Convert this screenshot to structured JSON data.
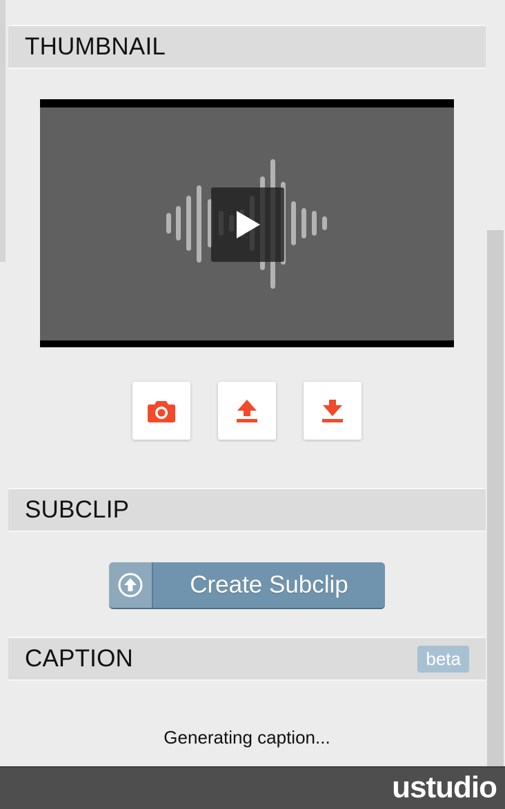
{
  "sections": {
    "thumbnail": {
      "title": "THUMBNAIL"
    },
    "subclip": {
      "title": "SUBCLIP"
    },
    "caption": {
      "title": "CAPTION",
      "badge": "beta"
    }
  },
  "thumbnail_tools": [
    {
      "name": "capture-frame",
      "icon": "camera-icon"
    },
    {
      "name": "upload-thumbnail",
      "icon": "upload-icon"
    },
    {
      "name": "download-thumbnail",
      "icon": "download-icon"
    }
  ],
  "subclip": {
    "button_label": "Create Subclip",
    "icon": "arrow-up-circle-icon"
  },
  "caption": {
    "status": "Generating caption..."
  },
  "footer": {
    "logo_text": "ustudio"
  },
  "colors": {
    "accent": "#f24a2a",
    "button_blue": "#7094ad",
    "badge_blue": "#a8c1d2",
    "footer": "#4e4e4e"
  }
}
